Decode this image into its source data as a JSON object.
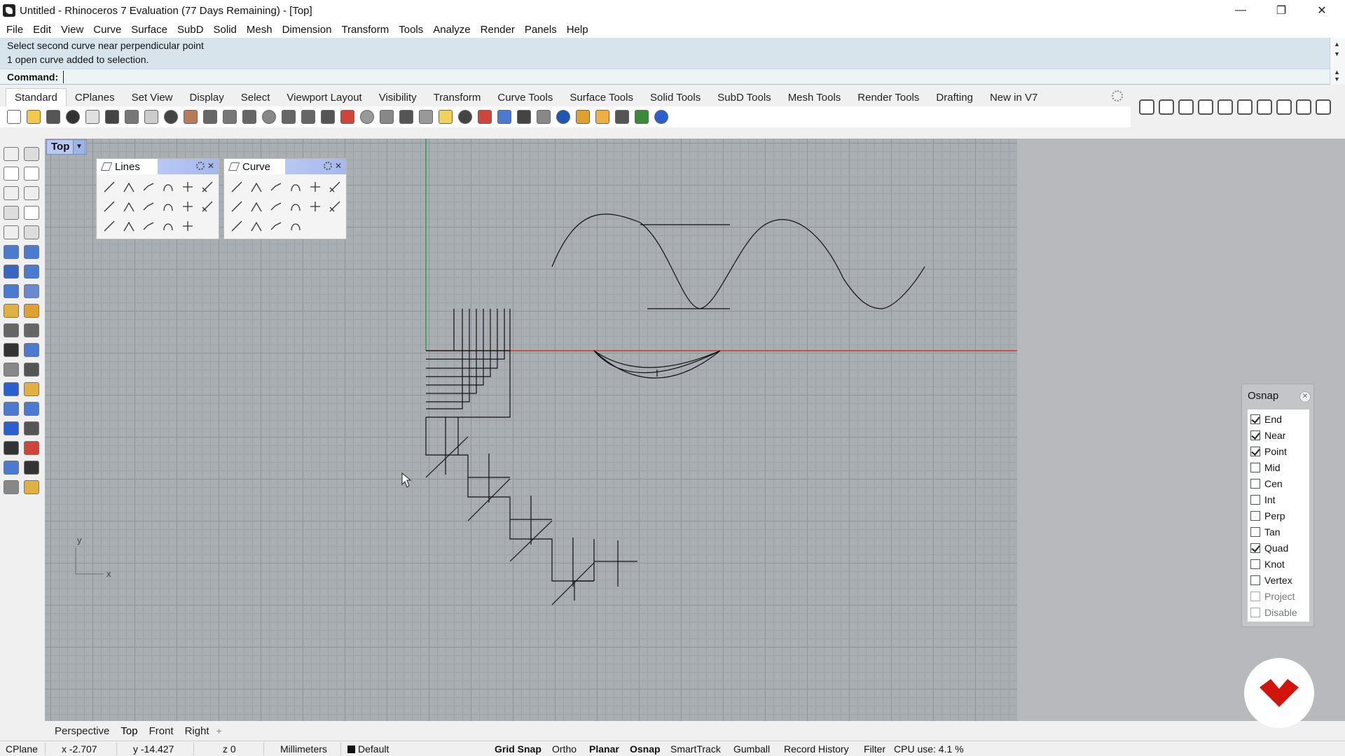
{
  "window": {
    "title": "Untitled - Rhinoceros 7 Evaluation (77 Days Remaining) - [Top]",
    "min": "—",
    "max": "❐",
    "close": "✕"
  },
  "menu": [
    "File",
    "Edit",
    "View",
    "Curve",
    "Surface",
    "SubD",
    "Solid",
    "Mesh",
    "Dimension",
    "Transform",
    "Tools",
    "Analyze",
    "Render",
    "Panels",
    "Help"
  ],
  "command": {
    "history": [
      "Select second curve near perpendicular point",
      "1 open curve added to selection."
    ],
    "label": "Command:",
    "value": ""
  },
  "toolbar_tabs": [
    "Standard",
    "CPlanes",
    "Set View",
    "Display",
    "Select",
    "Viewport Layout",
    "Visibility",
    "Transform",
    "Curve Tools",
    "Surface Tools",
    "Solid Tools",
    "SubD Tools",
    "Mesh Tools",
    "Render Tools",
    "Drafting",
    "New in V7"
  ],
  "viewport": {
    "name": "Top",
    "axis_x": "x",
    "axis_y": "y"
  },
  "palettes": {
    "lines": {
      "title": "Lines"
    },
    "curve": {
      "title": "Curve"
    }
  },
  "osnap": {
    "title": "Osnap",
    "items": [
      {
        "label": "End",
        "checked": true
      },
      {
        "label": "Near",
        "checked": true
      },
      {
        "label": "Point",
        "checked": true
      },
      {
        "label": "Mid",
        "checked": false
      },
      {
        "label": "Cen",
        "checked": false
      },
      {
        "label": "Int",
        "checked": false
      },
      {
        "label": "Perp",
        "checked": false
      },
      {
        "label": "Tan",
        "checked": false
      },
      {
        "label": "Quad",
        "checked": true
      },
      {
        "label": "Knot",
        "checked": false
      },
      {
        "label": "Vertex",
        "checked": false
      },
      {
        "label": "Project",
        "checked": false
      },
      {
        "label": "Disable",
        "checked": false
      }
    ]
  },
  "viewport_tabs": [
    "Perspective",
    "Top",
    "Front",
    "Right"
  ],
  "viewport_tab_add": "+",
  "status": {
    "cplane": "CPlane",
    "x": "x -2.707",
    "y": "y -14.427",
    "z": "z 0",
    "units": "Millimeters",
    "layer": "Default",
    "grid_snap": "Grid Snap",
    "ortho": "Ortho",
    "planar": "Planar",
    "osnap": "Osnap",
    "smarttrack": "SmartTrack",
    "gumball": "Gumball",
    "record_history": "Record History",
    "filter": "Filter",
    "cpu": "CPU use: 4.1 %"
  },
  "colors": {
    "x_axis": "#c0392b",
    "y_axis": "#2e9e3e",
    "logo": "#d2150c",
    "viewport_bg": "#a9aeb3"
  }
}
